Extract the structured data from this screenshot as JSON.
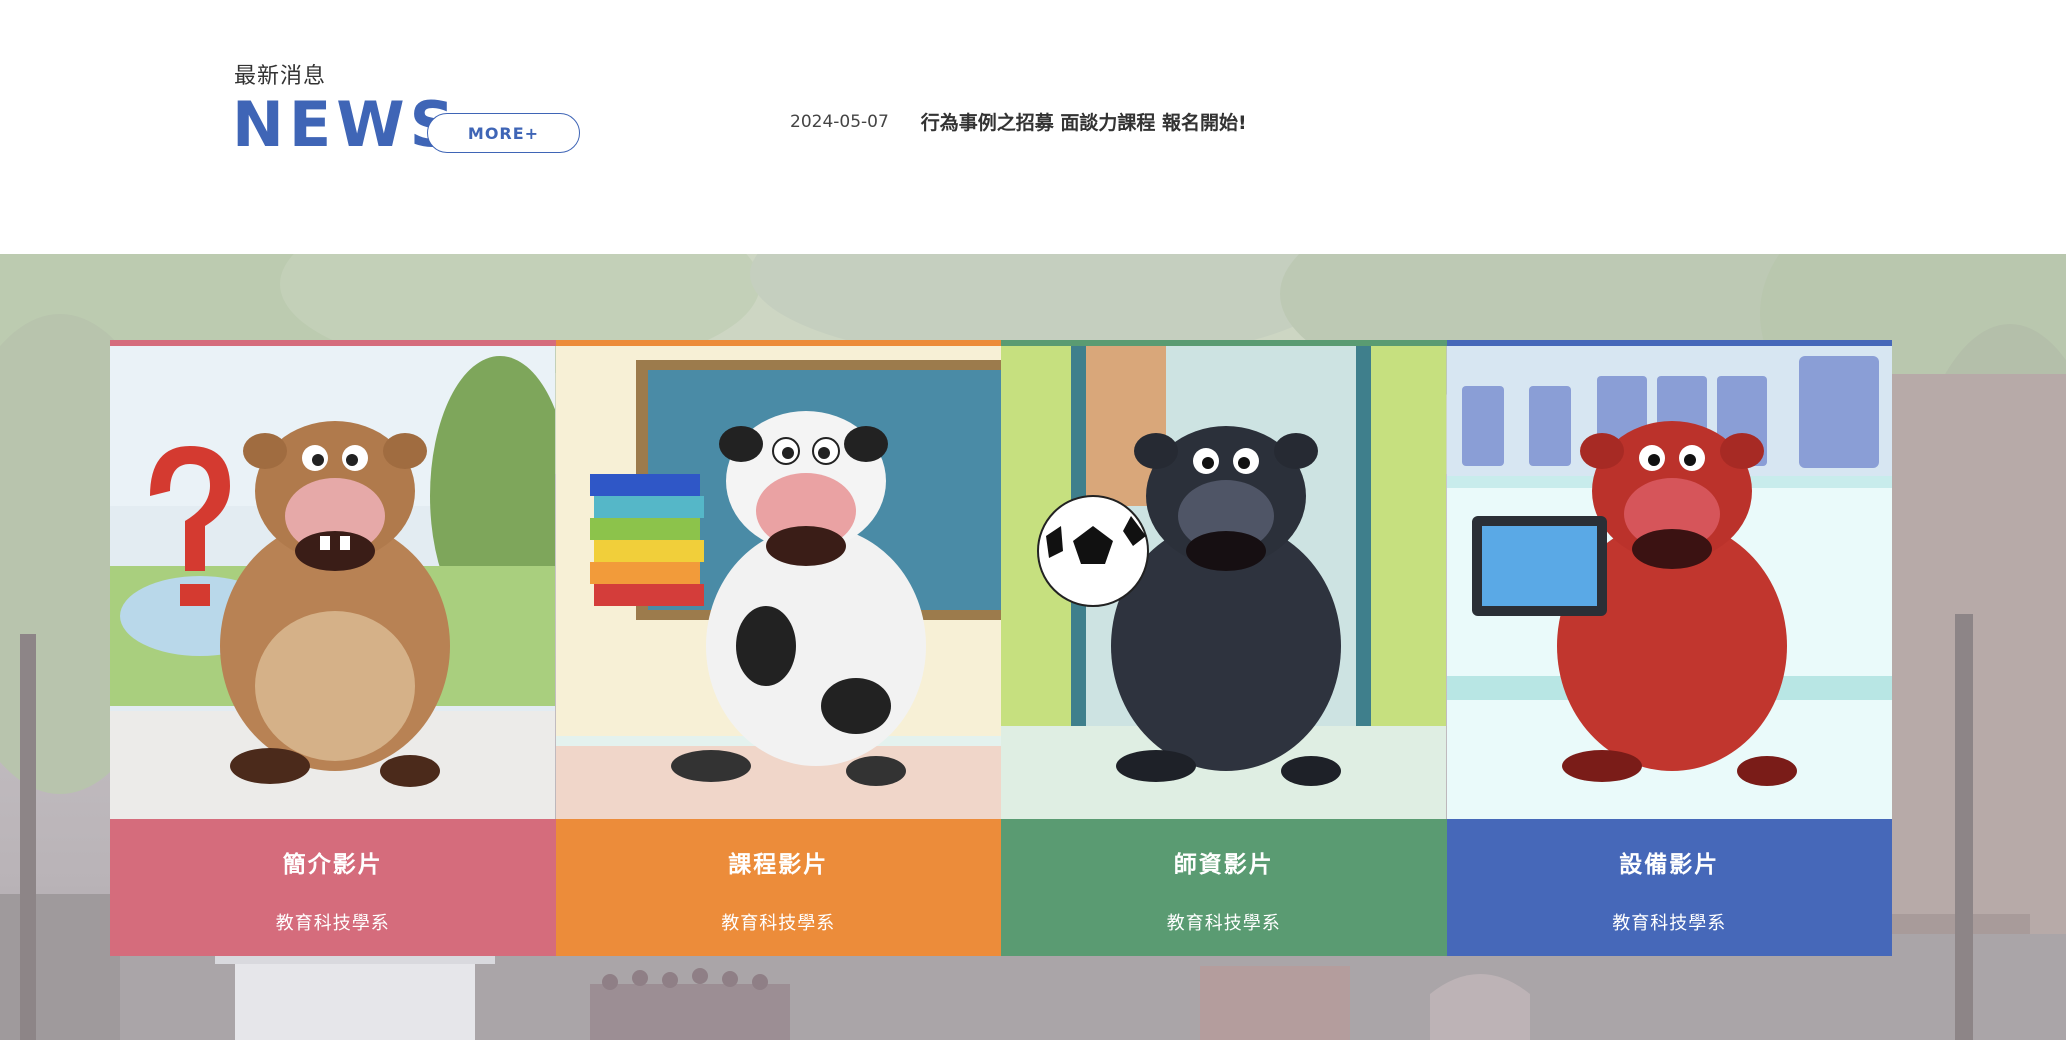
{
  "news": {
    "subtitle": "最新消息",
    "title": "NEWS",
    "more_label": "MORE+",
    "items": [
      {
        "date": "2024-05-07",
        "headline": "行為事例之招募 面談力課程 報名開始!"
      }
    ]
  },
  "cards": [
    {
      "title": "簡介影片",
      "subtitle": "教育科技學系",
      "color": "#d56c7c",
      "character": "brown-cow-question-mark"
    },
    {
      "title": "課程影片",
      "subtitle": "教育科技學系",
      "color": "#ec8c3a",
      "character": "holstein-cow-books"
    },
    {
      "title": "師資影片",
      "subtitle": "教育科技學系",
      "color": "#5a9b72",
      "character": "black-bull-soccer-ball"
    },
    {
      "title": "設備影片",
      "subtitle": "教育科技學系",
      "color": "#4668b9",
      "character": "red-bull-tablet"
    }
  ]
}
